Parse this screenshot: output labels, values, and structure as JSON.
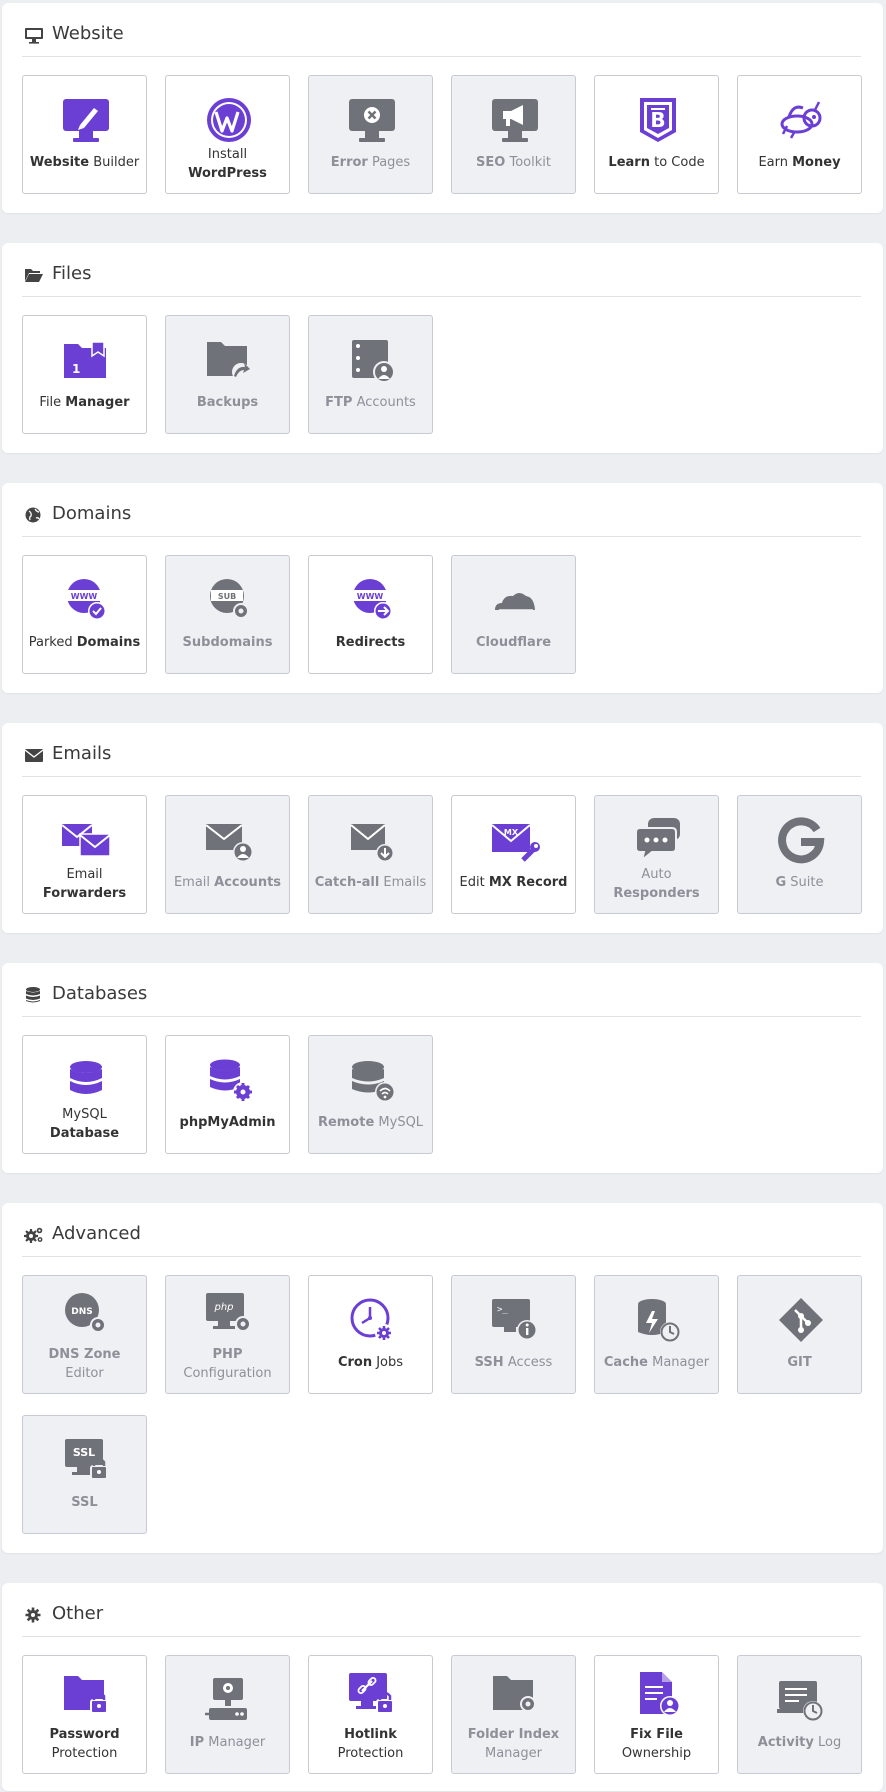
{
  "accent_color": "#6b3fd4",
  "disabled_color": "#6f7278",
  "sections": {
    "website": {
      "title": "Website",
      "icon": "monitor-icon",
      "tiles": [
        {
          "b1": "Website",
          "n1": " Builder",
          "icon": "website-builder-icon"
        },
        {
          "n1": "Install",
          "b2": "WordPress",
          "icon": "wordpress-icon"
        },
        {
          "b1": "Error",
          "n1": " Pages",
          "icon": "error-pages-icon"
        },
        {
          "b1": "SEO",
          "n1": " Toolkit",
          "icon": "seo-toolkit-icon"
        },
        {
          "b1": "Learn",
          "n1": " to Code",
          "icon": "learn-to-code-icon"
        },
        {
          "n1": "Earn ",
          "b1": "Money",
          "icon": "earn-money-icon"
        }
      ]
    },
    "files": {
      "title": "Files",
      "icon": "folder-open-icon",
      "tiles": [
        {
          "n1": "File ",
          "b1": "Manager",
          "icon": "file-manager-icon"
        },
        {
          "b1": "Backups",
          "icon": "backups-icon"
        },
        {
          "b1": "FTP",
          "n1": " Accounts",
          "icon": "ftp-accounts-icon"
        }
      ]
    },
    "domains": {
      "title": "Domains",
      "icon": "globe-icon",
      "tiles": [
        {
          "n1": "Parked ",
          "b1": "Domains",
          "icon": "parked-domains-icon"
        },
        {
          "b1": "Subdomains",
          "icon": "subdomains-icon"
        },
        {
          "b1": "Redirects",
          "icon": "redirects-icon"
        },
        {
          "b1": "Cloudflare",
          "icon": "cloudflare-icon"
        }
      ]
    },
    "emails": {
      "title": "Emails",
      "icon": "envelope-icon",
      "tiles": [
        {
          "n1": "Email",
          "b2": "Forwarders",
          "icon": "email-forwarders-icon"
        },
        {
          "n1": "Email ",
          "b1": "Accounts",
          "icon": "email-accounts-icon"
        },
        {
          "b1": "Catch-all",
          "n1": " Emails",
          "icon": "catch-all-icon"
        },
        {
          "n1": "Edit ",
          "b1": "MX Record",
          "icon": "mx-record-icon"
        },
        {
          "n1": "Auto",
          "b2": "Responders",
          "icon": "auto-responders-icon"
        },
        {
          "b1": "G",
          "n1": " Suite",
          "icon": "g-suite-icon"
        }
      ]
    },
    "databases": {
      "title": "Databases",
      "icon": "database-icon",
      "tiles": [
        {
          "n1": "MySQL",
          "b2": "Database",
          "icon": "mysql-database-icon"
        },
        {
          "b1": "phpMyAdmin",
          "icon": "phpmyadmin-icon"
        },
        {
          "b1": "Remote",
          "n1": " MySQL",
          "icon": "remote-mysql-icon"
        }
      ]
    },
    "advanced": {
      "title": "Advanced",
      "icon": "gears-icon",
      "tiles": [
        {
          "b1": "DNS Zone",
          "n2": "Editor",
          "icon": "dns-zone-icon"
        },
        {
          "b1": "PHP",
          "n2": "Configuration",
          "icon": "php-config-icon"
        },
        {
          "b1": "Cron",
          "n1": " Jobs",
          "icon": "cron-jobs-icon"
        },
        {
          "b1": "SSH",
          "n1": " Access",
          "icon": "ssh-access-icon"
        },
        {
          "b1": "Cache",
          "n1": " Manager",
          "icon": "cache-manager-icon"
        },
        {
          "b1": "GIT",
          "icon": "git-icon"
        },
        {
          "b1": "SSL",
          "icon": "ssl-icon"
        }
      ]
    },
    "other": {
      "title": "Other",
      "icon": "gear-icon",
      "tiles": [
        {
          "b1": "Password",
          "n2": "Protection",
          "icon": "password-protection-icon"
        },
        {
          "b1": "IP",
          "n1": " Manager",
          "icon": "ip-manager-icon"
        },
        {
          "b1": "Hotlink",
          "n2": "Protection",
          "icon": "hotlink-protection-icon"
        },
        {
          "b1": "Folder Index",
          "n2": "Manager",
          "icon": "folder-index-icon"
        },
        {
          "b1": "Fix File",
          "n2": "Ownership",
          "icon": "fix-file-ownership-icon"
        },
        {
          "b1": "Activity",
          "n1": " Log",
          "icon": "activity-log-icon"
        }
      ]
    }
  }
}
